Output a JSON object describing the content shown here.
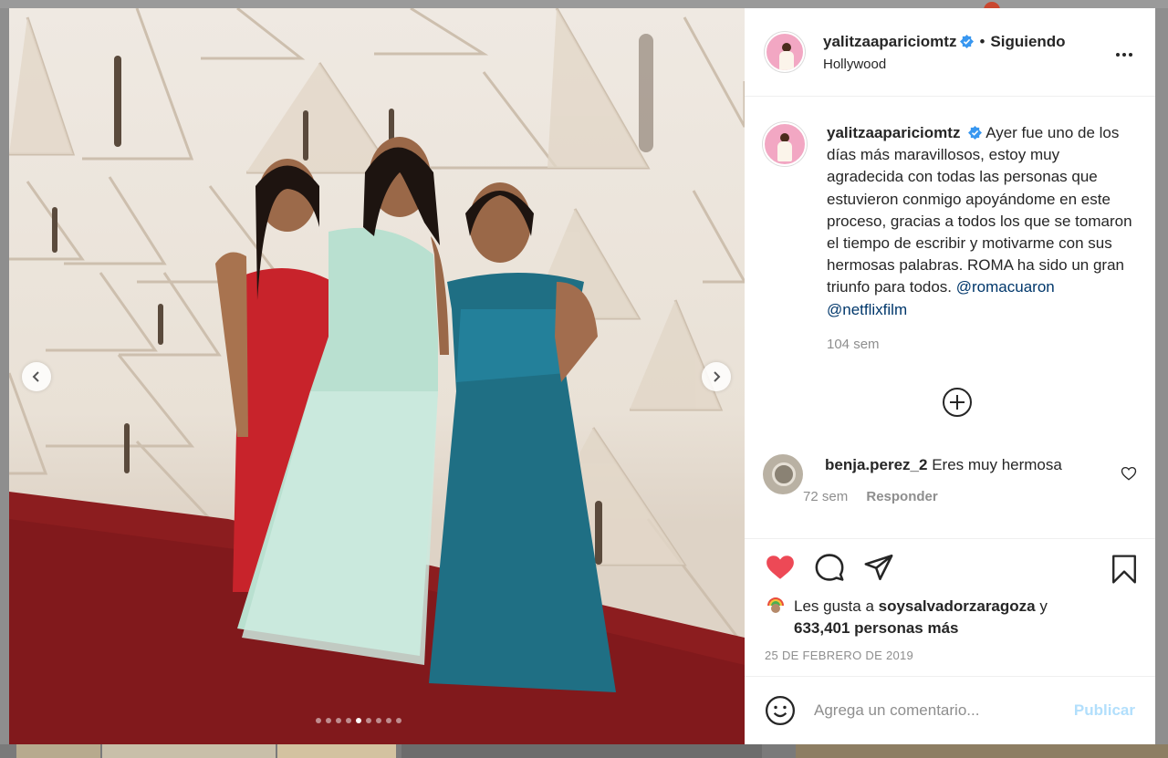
{
  "post": {
    "username": "yalitzaapariciomtz",
    "follow_label": "Siguiendo",
    "bullet": "•",
    "location": "Hollywood",
    "caption": "Ayer fue uno de los días más maravillosos, estoy muy agradecida con todas las personas que estuvieron conmigo apoyándome en este proceso, gracias a todos los que se tomaron el tiempo de escribir y motivarme con sus hermosas palabras. ROMA ha sido un gran triunfo para todos.",
    "mention_1": "@romacuaron",
    "mention_2": "@netflixfilm",
    "age": "104 sem",
    "slides_total": 9,
    "slide_active": 5
  },
  "comments": [
    {
      "username": "benja.perez_2",
      "text": "Eres muy hermosa",
      "age": "72 sem",
      "reply_label": "Responder"
    }
  ],
  "likes": {
    "prefix": "Les gusta a",
    "user": "soysalvadorzaragoza",
    "conj": "y",
    "others": "633,401 personas más"
  },
  "date": "25 DE FEBRERO DE 2019",
  "add_comment": {
    "placeholder": "Agrega un comentario...",
    "publish_label": "Publicar"
  },
  "colors": {
    "liked_heart": "#ed4956",
    "verified": "#3897f0",
    "link": "#00376b",
    "publish_disabled": "#b2dffc"
  },
  "icons": [
    "verified-badge-icon",
    "more-options-icon",
    "chevron-left-icon",
    "chevron-right-icon",
    "plus-circle-icon",
    "heart-icon",
    "comment-icon",
    "share-icon",
    "bookmark-icon",
    "emoji-icon"
  ]
}
